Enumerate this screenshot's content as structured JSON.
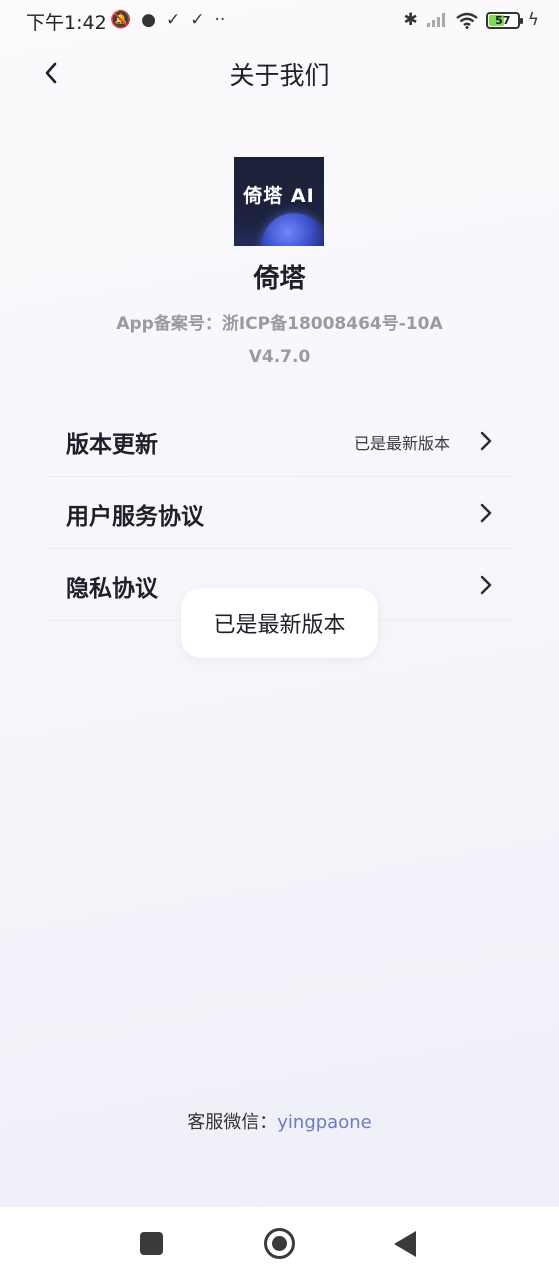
{
  "status_bar": {
    "time": "下午1:42",
    "left_icons": [
      "mute-icon",
      "chat-bubble-icon",
      "check-icon",
      "check-icon",
      "more-dots-icon"
    ],
    "right_icons": [
      "bluetooth-icon",
      "signal-icon",
      "wifi-icon",
      "battery-icon",
      "charging-icon"
    ],
    "battery_level": "57"
  },
  "header": {
    "title": "关于我们"
  },
  "app": {
    "logo_text": "倚塔 AI",
    "name": "倚塔",
    "icp": "App备案号：浙ICP备18008464号-10A",
    "version": "V4.7.0"
  },
  "menu": {
    "items": [
      {
        "label": "版本更新",
        "value": "已是最新版本"
      },
      {
        "label": "用户服务协议",
        "value": ""
      },
      {
        "label": "隐私协议",
        "value": ""
      }
    ]
  },
  "toast": {
    "message": "已是最新版本"
  },
  "footer": {
    "contact_label": "客服微信：",
    "contact_value": "yingpaone"
  },
  "colors": {
    "link": "#6b7bc4",
    "muted_text": "#9a9aa3",
    "battery_fill": "#7ed957"
  }
}
